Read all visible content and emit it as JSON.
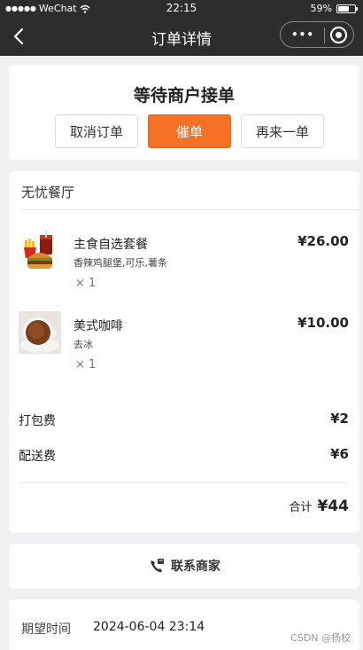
{
  "status_bar": {
    "carrier": "WeChat",
    "time": "22:15",
    "battery": "59%"
  },
  "nav": {
    "title": "订单详情",
    "more_label": "•••"
  },
  "order_status": {
    "state": "等待商户接单",
    "cancel_label": "取消订单",
    "urge_label": "催单",
    "reorder_label": "再来一单",
    "accent_color": "#f47126"
  },
  "order": {
    "shop_name": "无忧餐厅",
    "items": [
      {
        "name": "主食自选套餐",
        "desc": "香辣鸡腿堡,可乐,薯条",
        "qty": "× 1",
        "price": "¥26.00",
        "icon": "burger-combo-image"
      },
      {
        "name": "美式咖啡",
        "desc": "去冰",
        "qty": "× 1",
        "price": "¥10.00",
        "icon": "coffee-cup-image"
      }
    ],
    "packing_label": "打包费",
    "packing_fee": "¥2",
    "delivery_label": "配送费",
    "delivery_fee": "¥6",
    "total_label": "合计",
    "total_value": "¥44"
  },
  "contact": {
    "label": "联系商家",
    "icon": "phone-icon"
  },
  "expected": {
    "label": "期望时间",
    "value": "2024-06-04 23:14"
  },
  "watermark": "CSDN @杨校"
}
